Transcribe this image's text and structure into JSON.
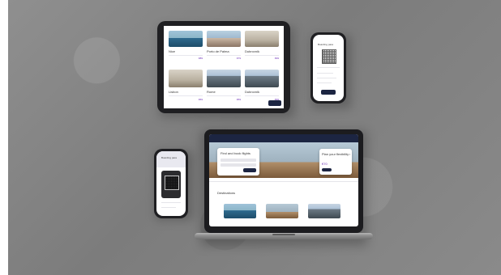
{
  "tablet": {
    "destinations": [
      {
        "name": "Nice",
        "price": "€89"
      },
      {
        "name": "Porto de Palma",
        "price": "€79"
      },
      {
        "name": "Dubrovnik",
        "price": "€99"
      },
      {
        "name": "Lisbon",
        "price": "€69"
      },
      {
        "name": "Rome",
        "price": "€59"
      },
      {
        "name": "Dubrovnik",
        "price": "€99"
      }
    ]
  },
  "phone_top": {
    "title": "Boarding pass"
  },
  "phone_left": {
    "title": "Boarding pass"
  },
  "laptop": {
    "hero_title": "Find and book flights",
    "promo_title": "Plan your flexibility with flexibility",
    "promo_price": "€70",
    "section_title": "Destinations"
  }
}
